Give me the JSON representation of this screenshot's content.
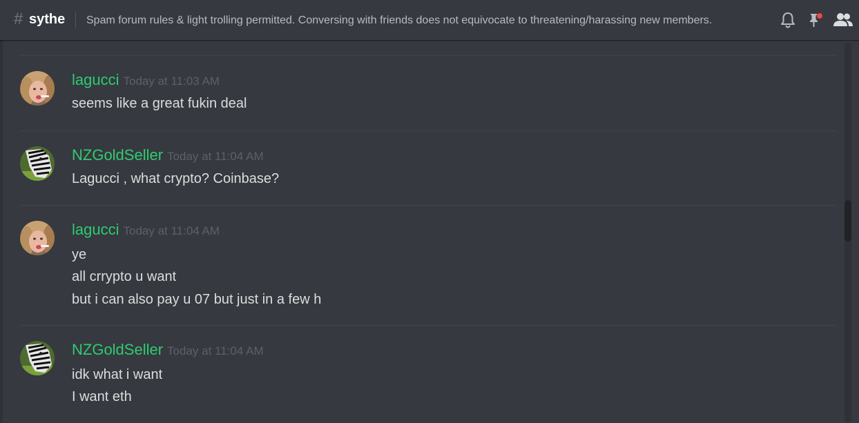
{
  "header": {
    "channel_name": "sythe",
    "topic": "Spam forum rules & light trolling permitted. Conversing with friends does not equivocate to threatening/harassing new members.",
    "icons": [
      "bell-icon",
      "pin-icon",
      "members-icon"
    ]
  },
  "colors": {
    "username": "#2ecc71",
    "background": "#36393f",
    "notification_dot": "#f04747"
  },
  "messages": [
    {
      "author": "lagucci",
      "avatar": "lagucci-avatar",
      "timestamp": "Today at 11:03 AM",
      "lines": [
        "seems like a great fukin deal"
      ]
    },
    {
      "author": "NZGoldSeller",
      "avatar": "zebra-avatar",
      "timestamp": "Today at 11:04 AM",
      "lines": [
        "Lagucci , what crypto? Coinbase?"
      ]
    },
    {
      "author": "lagucci",
      "avatar": "lagucci-avatar",
      "timestamp": "Today at 11:04 AM",
      "lines": [
        "ye",
        "all crrypto u want",
        "but i can also pay u 07 but just in a few h"
      ]
    },
    {
      "author": "NZGoldSeller",
      "avatar": "zebra-avatar",
      "timestamp": "Today at 11:04 AM",
      "lines": [
        "idk what i want",
        "I want eth"
      ]
    }
  ]
}
